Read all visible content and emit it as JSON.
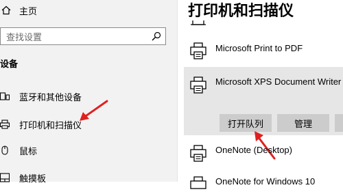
{
  "sidebar": {
    "home_label": "主页",
    "search_placeholder": "查找设置",
    "section_title": "设备",
    "items": [
      {
        "label": "蓝牙和其他设备",
        "icon": "devices-icon"
      },
      {
        "label": "打印机和扫描仪",
        "icon": "printer-icon"
      },
      {
        "label": "鼠标",
        "icon": "mouse-icon"
      },
      {
        "label": "触摸板",
        "icon": "touchpad-icon"
      }
    ]
  },
  "main": {
    "title": "打印机和扫描仪",
    "printers": [
      {
        "name": "Microsoft Print to PDF"
      },
      {
        "name": "Microsoft XPS Document Writer"
      },
      {
        "name": "OneNote (Desktop)"
      },
      {
        "name": "OneNote for Windows 10"
      }
    ],
    "buttons": {
      "open_queue": "打开队列",
      "manage": "管理"
    }
  },
  "colors": {
    "annotation_arrow": "#e02020",
    "selected_background": "#e6e6e6",
    "button_background": "#cccccc"
  }
}
